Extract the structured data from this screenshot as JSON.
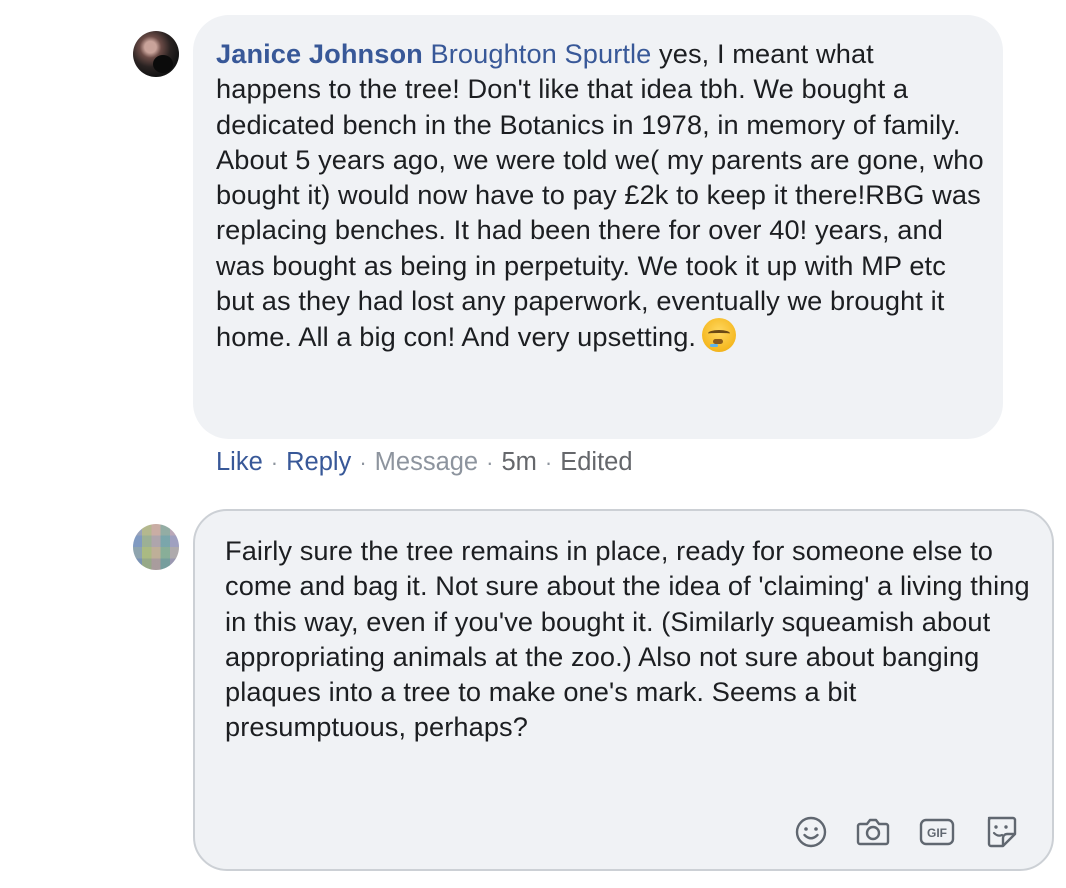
{
  "comment": {
    "author": "Janice Johnson",
    "tagged_user": "Broughton Spurtle",
    "text": "yes, I meant what happens to the tree! Don't like that idea tbh. We bought a dedicated bench in the Botanics in 1978, in memory of family. About 5 years ago, we were told we( my parents are gone, who bought it) would now have to pay £2k to keep it there!RBG was replacing benches. It had been there for over 40! years, and was bought as being in perpetuity. We took it up with MP etc but as they had lost any paperwork, eventually we brought it home. All a big con! And very upsetting.",
    "emoji": "sad-emoji-icon",
    "actions": {
      "like": "Like",
      "reply": "Reply",
      "message": "Message",
      "time": "5m",
      "edited": "Edited",
      "separator": "·"
    }
  },
  "composer": {
    "text": "Fairly sure the tree remains in place, ready for someone else to come and bag it. Not sure about the idea of 'claiming' a living thing in this way, even if you've bought it. (Similarly squeamish about appropriating animals at the zoo.) Also not sure about banging plaques into a tree to make one's mark. Seems a bit presumptuous, perhaps?",
    "tools": [
      "emoji-icon",
      "camera-icon",
      "gif-icon",
      "sticker-icon"
    ],
    "gif_label": "GIF"
  },
  "colors": {
    "link": "#385898",
    "bubble": "#f0f2f5",
    "muted": "#8d949e",
    "border": "#ccd0d5"
  }
}
